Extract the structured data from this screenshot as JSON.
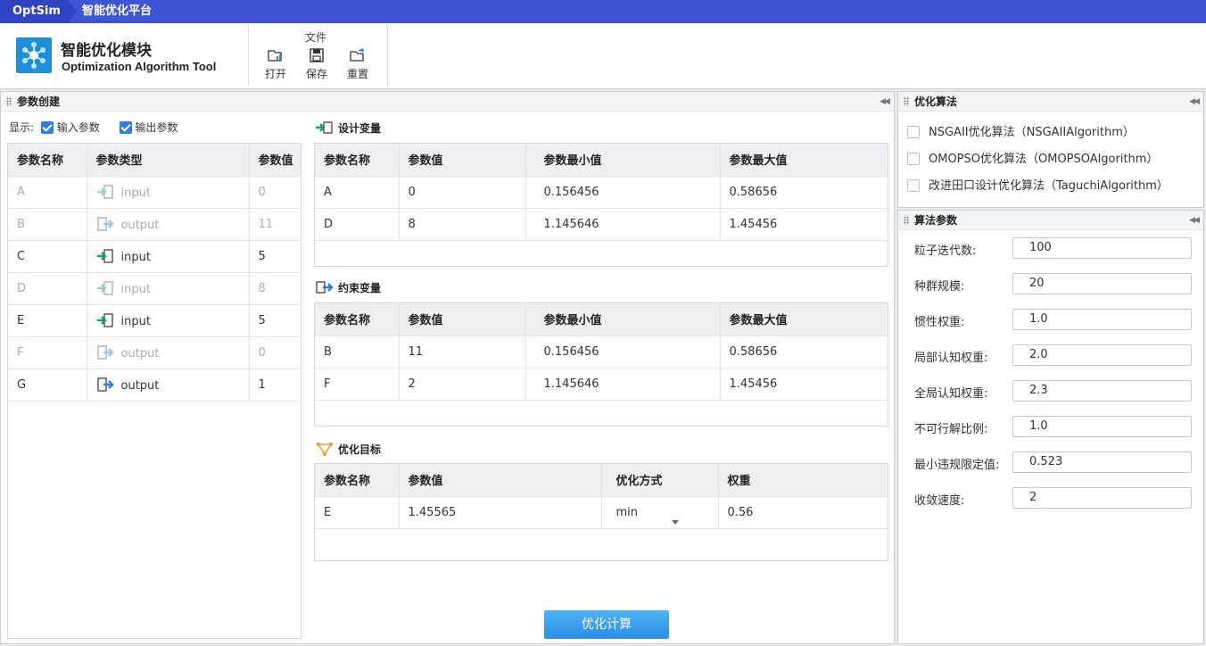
{
  "titlebar": {
    "app": "OptSim",
    "title": "智能优化平台"
  },
  "ribbon": {
    "module_title": "智能优化模块",
    "module_subtitle": "Optimization Algorithm Tool",
    "group_label": "文件",
    "open": "打开",
    "save": "保存",
    "reset": "重置"
  },
  "param_panel": {
    "title": "参数创建",
    "show_label": "显示:",
    "show_input": "输入参数",
    "show_output": "输出参数",
    "columns": [
      "参数名称",
      "参数类型",
      "参数值"
    ],
    "rows": [
      {
        "name": "A",
        "type": "input",
        "value": "0",
        "dim": true
      },
      {
        "name": "B",
        "type": "output",
        "value": "11",
        "dim": true
      },
      {
        "name": "C",
        "type": "input",
        "value": "5",
        "dim": false
      },
      {
        "name": "D",
        "type": "input",
        "value": "8",
        "dim": true
      },
      {
        "name": "E",
        "type": "input",
        "value": "5",
        "dim": false
      },
      {
        "name": "F",
        "type": "output",
        "value": "0",
        "dim": true
      },
      {
        "name": "G",
        "type": "output",
        "value": "1",
        "dim": false
      }
    ]
  },
  "design_vars": {
    "title": "设计变量",
    "columns": [
      "参数名称",
      "参数值",
      "参数最小值",
      "参数最大值"
    ],
    "rows": [
      [
        "A",
        "0",
        "0.156456",
        "0.58656"
      ],
      [
        "D",
        "8",
        "1.145646",
        "1.45456"
      ]
    ]
  },
  "constraint_vars": {
    "title": "约束变量",
    "columns": [
      "参数名称",
      "参数值",
      "参数最小值",
      "参数最大值"
    ],
    "rows": [
      [
        "B",
        "11",
        "0.156456",
        "0.58656"
      ],
      [
        "F",
        "2",
        "1.145646",
        "1.45456"
      ]
    ]
  },
  "objectives": {
    "title": "优化目标",
    "columns": [
      "参数名称",
      "参数值",
      "优化方式",
      "权重"
    ],
    "rows": [
      [
        "E",
        "1.45565",
        "min",
        "0.56"
      ]
    ]
  },
  "optimize_button": "优化计算",
  "algo_panel": {
    "title": "优化算法",
    "items": [
      "NSGAII优化算法（NSGAIIAlgorithm）",
      "OMOPSO优化算法（OMOPSOAlgorithm）",
      "改进田口设计优化算法（TaguchiAlgorithm）"
    ]
  },
  "algo_params": {
    "title": "算法参数",
    "items": [
      {
        "label": "粒子迭代数:",
        "value": "100"
      },
      {
        "label": "种群规模:",
        "value": "20"
      },
      {
        "label": "惯性权重:",
        "value": "1.0"
      },
      {
        "label": "局部认知权重:",
        "value": "2.0"
      },
      {
        "label": "全局认知权重:",
        "value": "2.3"
      },
      {
        "label": "不可行解比例:",
        "value": "1.0"
      },
      {
        "label": "最小违规限定值:",
        "value": "0.523"
      },
      {
        "label": "收敛速度:",
        "value": "2"
      }
    ]
  },
  "colors": {
    "titlebar": "#3f55d6",
    "accent": "#2f7de0",
    "input_icon": "#19a35a",
    "output_icon": "#2f7de0"
  }
}
